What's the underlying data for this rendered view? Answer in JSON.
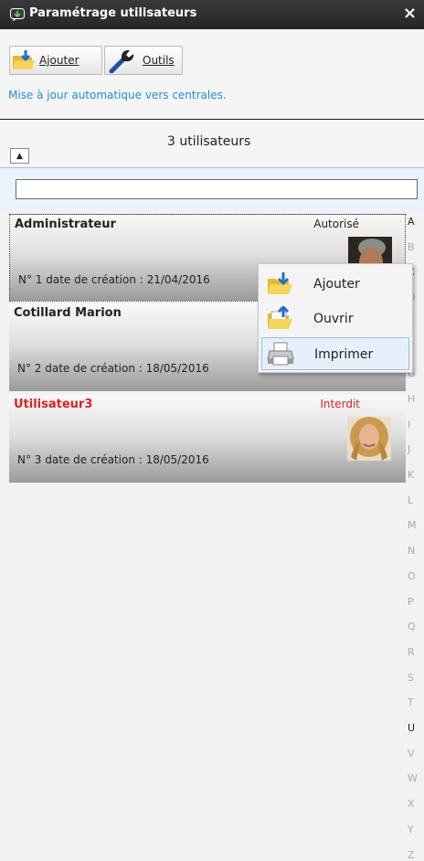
{
  "window": {
    "title": "Paramétrage utilisateurs",
    "close_label": "×"
  },
  "toolbar": {
    "add_label": "Ajouter",
    "tools_label": "Outils"
  },
  "info_text": "Mise à jour automatique vers centrales.",
  "list": {
    "count_label": "3 utilisateurs",
    "collapse_symbol": "▲",
    "search_value": "",
    "users": [
      {
        "name": "Administrateur",
        "status": "Autorisé",
        "meta": "N° 1  date de création : 21/04/2016"
      },
      {
        "name": "Cotillard Marion",
        "status": "",
        "meta": "N° 2  date de création : 18/05/2016"
      },
      {
        "name": "Utilisateur3",
        "status": "Interdit",
        "meta": "N° 3  date de création : 18/05/2016"
      }
    ]
  },
  "alphabet": [
    "A",
    "B",
    "C",
    "D",
    "E",
    "F",
    "G",
    "H",
    "I",
    "J",
    "K",
    "L",
    "M",
    "N",
    "O",
    "P",
    "Q",
    "R",
    "S",
    "T",
    "U",
    "V",
    "W",
    "X",
    "Y",
    "Z"
  ],
  "alphabet_active": [
    "A",
    "C",
    "U"
  ],
  "context_menu": {
    "items": [
      "Ajouter",
      "Ouvrir",
      "Imprimer"
    ]
  },
  "colors": {
    "accent": "#1e8fd6",
    "forbidden": "#e02020",
    "titlebar": "#2b2b2b"
  }
}
